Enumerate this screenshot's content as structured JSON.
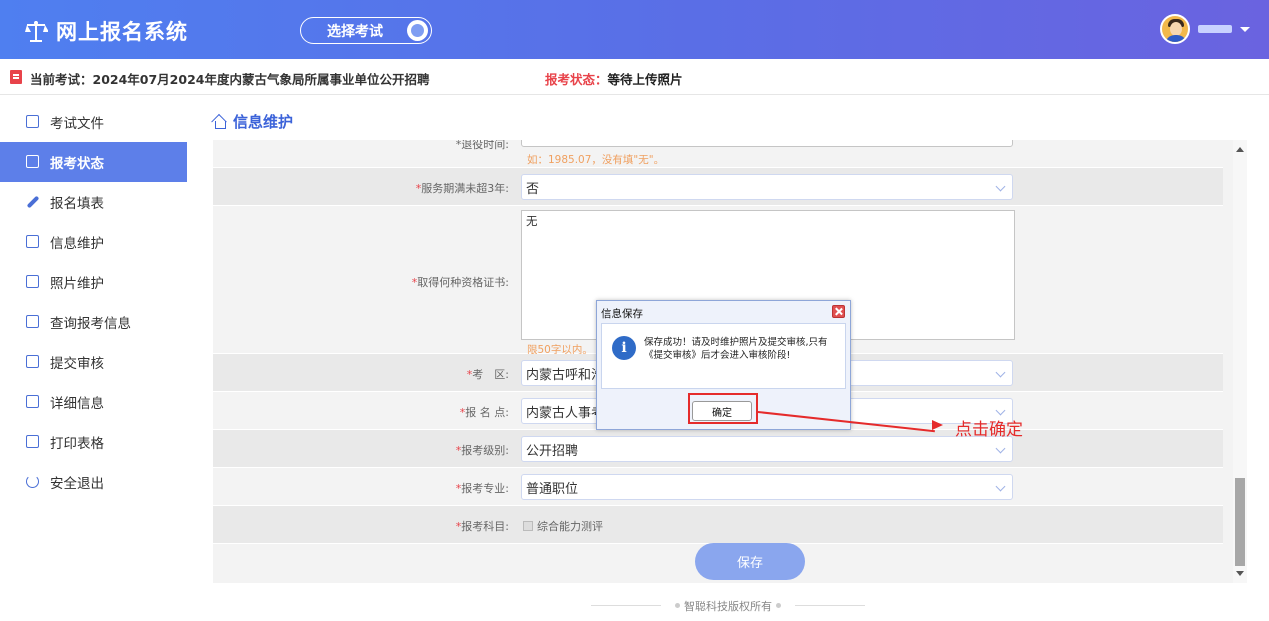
{
  "header": {
    "app_title": "网上报名系统",
    "select_exam_label": "选择考试"
  },
  "infobar": {
    "current_exam": "当前考试：2024年07月2024年度内蒙古气象局所属事业单位公开招聘",
    "status_label": "报考状态：",
    "status_value": "等待上传照片"
  },
  "sidebar": {
    "items": [
      {
        "label": "考试文件",
        "icon": "document-icon"
      },
      {
        "label": "报考状态",
        "icon": "monitor-icon",
        "active": true
      },
      {
        "label": "报名填表",
        "icon": "pencil-icon"
      },
      {
        "label": "信息维护",
        "icon": "form-icon"
      },
      {
        "label": "照片维护",
        "icon": "image-icon"
      },
      {
        "label": "查询报考信息",
        "icon": "search-doc-icon"
      },
      {
        "label": "提交审核",
        "icon": "calendar-check-icon"
      },
      {
        "label": "详细信息",
        "icon": "details-icon"
      },
      {
        "label": "打印表格",
        "icon": "printer-icon"
      },
      {
        "label": "安全退出",
        "icon": "power-icon"
      }
    ]
  },
  "main": {
    "section_title": "信息维护",
    "form": {
      "retire_label": "*退役时间:",
      "retire_hint": "如：1985.07，没有填\"无\"。",
      "service_label": "*服务期满未超3年:",
      "service_value": "否",
      "cert_label": "*取得何种资格证书:",
      "cert_value": "无",
      "cert_hint": "限50字以内。",
      "area_label": "*考    区:",
      "area_value": "内蒙古呼和浩",
      "site_label": "*报 名 点:",
      "site_value": "内蒙古人事考",
      "level_label": "*报考级别:",
      "level_value": "公开招聘",
      "major_label": "*报考专业:",
      "major_value": "普通职位",
      "subject_label": "*报考科目:",
      "subject_value": "综合能力测评",
      "save_label": "保存"
    }
  },
  "dialog": {
    "title": "信息保存",
    "message": "保存成功！请及时维护照片及提交审核,只有《提交审核》后才会进入审核阶段!",
    "ok_label": "确定"
  },
  "annotation": {
    "text": "点击确定",
    "color": "#e52b2b"
  },
  "footer": {
    "copyright": "智聪科技版权所有"
  },
  "colors": {
    "header_gradient_start": "#4f7ff0",
    "header_gradient_end": "#6a63e0",
    "sidebar_active": "#5d7fe9",
    "status_red": "#e8434a",
    "title_blue": "#3c63d9"
  }
}
